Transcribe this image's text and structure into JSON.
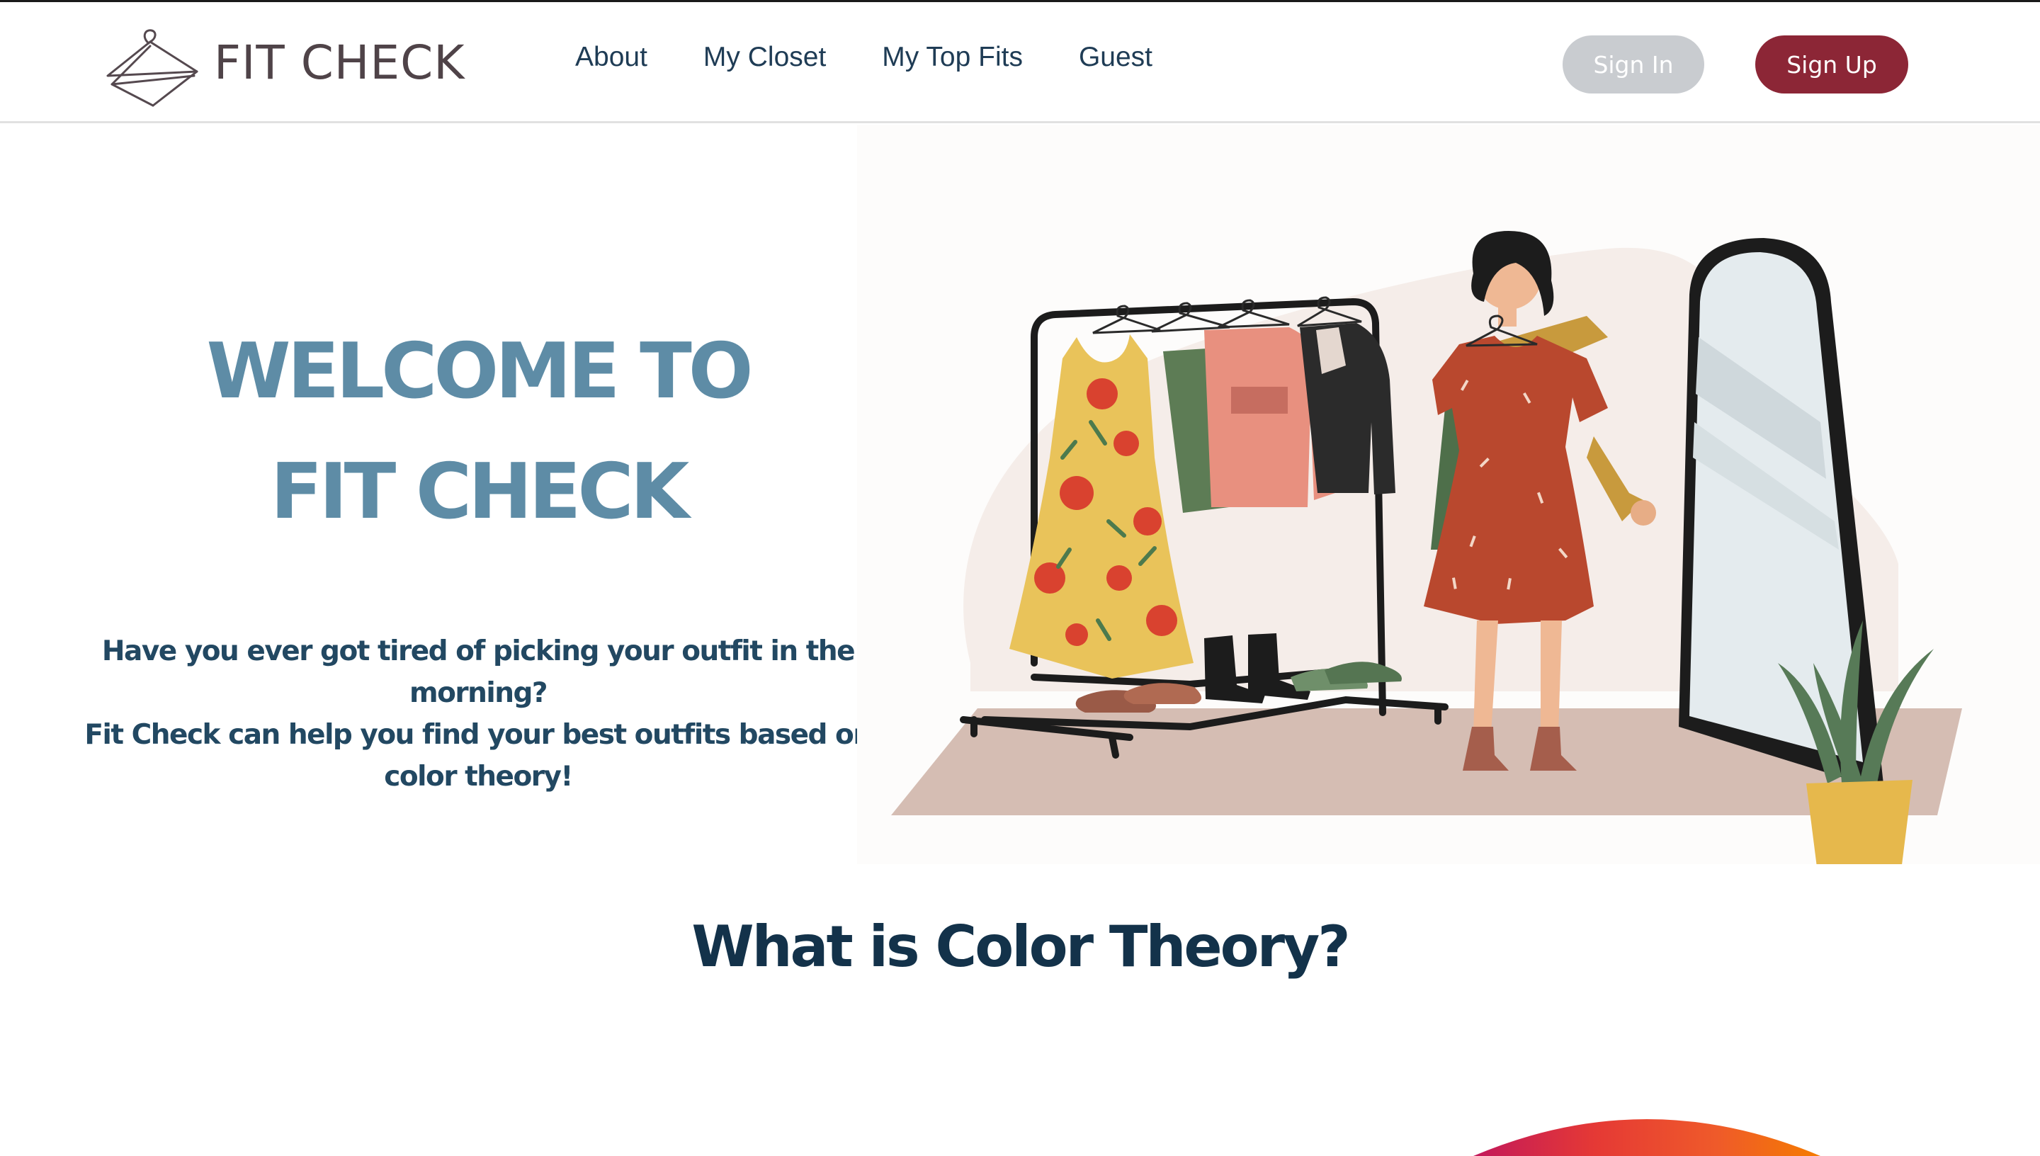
{
  "brand": {
    "name": "FIT CHECK",
    "logo_icon": "hanger-icon"
  },
  "nav": {
    "links": [
      "About",
      "My Closet",
      "My Top Fits",
      "Guest"
    ],
    "sign_in": "Sign In",
    "sign_up": "Sign Up"
  },
  "hero": {
    "title_line1": "WELCOME TO",
    "title_line2": "FIT CHECK",
    "subtitle_lines": [
      "Have you ever got tired of picking your outfit in the",
      "morning?",
      "Fit Check can help you find your best outfits based on",
      "color theory!"
    ],
    "illustration": "woman-choosing-outfit-illustration"
  },
  "section": {
    "title": "What is Color Theory?"
  },
  "colors": {
    "brand_blue": "#5e8ca6",
    "text_navy": "#224862",
    "signup_red": "#8c2636",
    "signin_gray": "#c9ccd0"
  }
}
